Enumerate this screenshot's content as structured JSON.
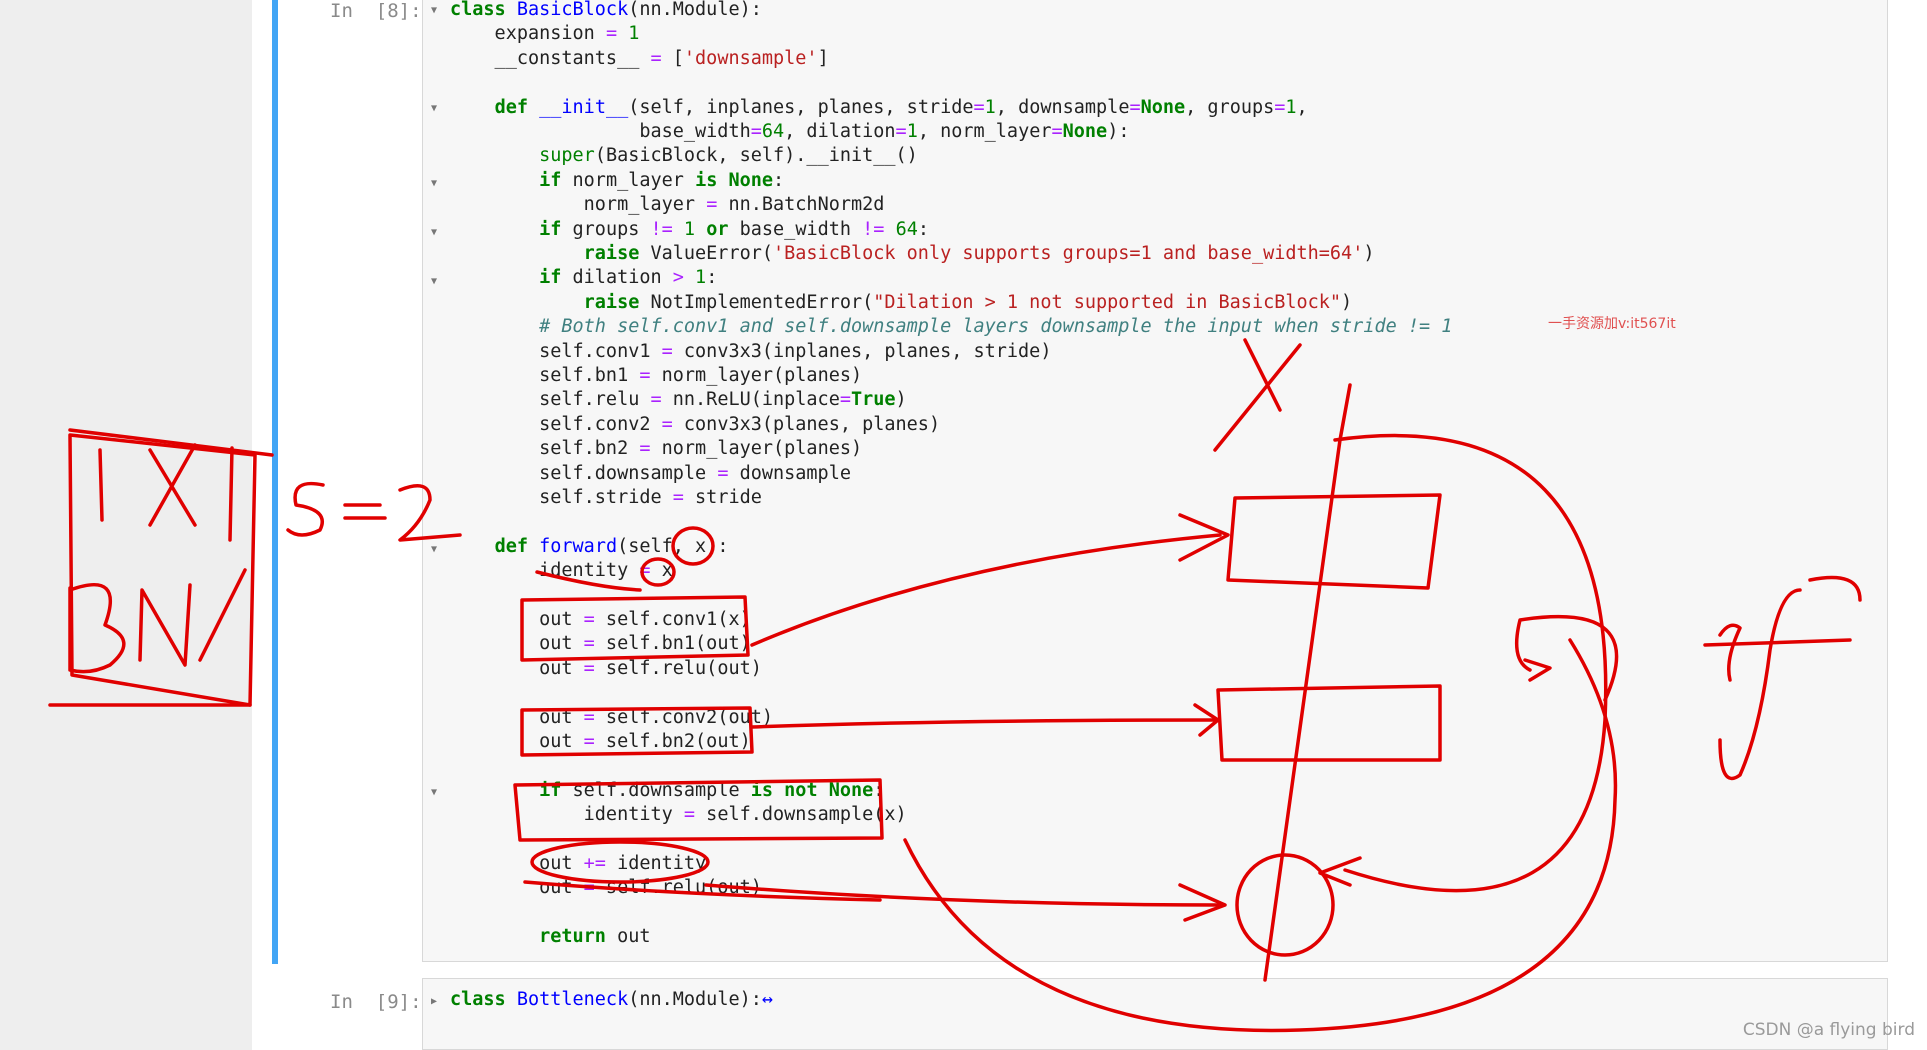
{
  "cells": [
    {
      "prompt": "In  [8]:",
      "lines": [
        [
          [
            "kw",
            "class "
          ],
          [
            "nc",
            "BasicBlock"
          ],
          [
            "",
            "(nn.Module):"
          ]
        ],
        [
          [
            "",
            "    expansion "
          ],
          [
            "op",
            "="
          ],
          [
            "nu",
            " 1"
          ]
        ],
        [
          [
            "",
            "    __constants__ "
          ],
          [
            "op",
            "="
          ],
          [
            "",
            " ["
          ],
          [
            "st",
            "'downsample'"
          ],
          [
            "",
            "]"
          ]
        ],
        [
          [
            "",
            ""
          ]
        ],
        [
          [
            "",
            "    "
          ],
          [
            "kw",
            "def "
          ],
          [
            "nf",
            "__init__"
          ],
          [
            "",
            "(self, inplanes, planes, stride"
          ],
          [
            "op",
            "="
          ],
          [
            "nu",
            "1"
          ],
          [
            "",
            ", downsample"
          ],
          [
            "op",
            "="
          ],
          [
            "kc",
            "None"
          ],
          [
            "",
            ", groups"
          ],
          [
            "op",
            "="
          ],
          [
            "nu",
            "1"
          ],
          [
            "",
            ","
          ]
        ],
        [
          [
            "",
            "                 base_width"
          ],
          [
            "op",
            "="
          ],
          [
            "nu",
            "64"
          ],
          [
            "",
            ", dilation"
          ],
          [
            "op",
            "="
          ],
          [
            "nu",
            "1"
          ],
          [
            "",
            ", norm_layer"
          ],
          [
            "op",
            "="
          ],
          [
            "kc",
            "None"
          ],
          [
            "",
            "):"
          ]
        ],
        [
          [
            "",
            "        "
          ],
          [
            "bi",
            "super"
          ],
          [
            "",
            "(BasicBlock, self).__init__()"
          ]
        ],
        [
          [
            "",
            "        "
          ],
          [
            "kw",
            "if "
          ],
          [
            "",
            "norm_layer "
          ],
          [
            "kw",
            "is "
          ],
          [
            "kc",
            "None"
          ],
          [
            "",
            ":"
          ]
        ],
        [
          [
            "",
            "            norm_layer "
          ],
          [
            "op",
            "="
          ],
          [
            "",
            " nn.BatchNorm2d"
          ]
        ],
        [
          [
            "",
            "        "
          ],
          [
            "kw",
            "if "
          ],
          [
            "",
            "groups "
          ],
          [
            "op",
            "!="
          ],
          [
            "nu",
            " 1 "
          ],
          [
            "kw",
            "or "
          ],
          [
            "",
            "base_width "
          ],
          [
            "op",
            "!="
          ],
          [
            "nu",
            " 64"
          ],
          [
            "",
            ":"
          ]
        ],
        [
          [
            "",
            "            "
          ],
          [
            "kw",
            "raise "
          ],
          [
            "",
            "ValueError("
          ],
          [
            "st",
            "'BasicBlock only supports groups=1 and base_width=64'"
          ],
          [
            "",
            ")"
          ]
        ],
        [
          [
            "",
            "        "
          ],
          [
            "kw",
            "if "
          ],
          [
            "",
            "dilation "
          ],
          [
            "op",
            ">"
          ],
          [
            "nu",
            " 1"
          ],
          [
            "",
            ":"
          ]
        ],
        [
          [
            "",
            "            "
          ],
          [
            "kw",
            "raise "
          ],
          [
            "",
            "NotImplementedError("
          ],
          [
            "st",
            "\"Dilation > 1 not supported in BasicBlock\""
          ],
          [
            "",
            ")"
          ]
        ],
        [
          [
            "",
            "        "
          ],
          [
            "cm",
            "# Both self.conv1 and self.downsample layers downsample the input when stride != 1"
          ]
        ],
        [
          [
            "",
            "        self.conv1 "
          ],
          [
            "op",
            "="
          ],
          [
            "",
            " conv3x3(inplanes, planes, stride)"
          ]
        ],
        [
          [
            "",
            "        self.bn1 "
          ],
          [
            "op",
            "="
          ],
          [
            "",
            " norm_layer(planes)"
          ]
        ],
        [
          [
            "",
            "        self.relu "
          ],
          [
            "op",
            "="
          ],
          [
            "",
            " nn.ReLU(inplace"
          ],
          [
            "op",
            "="
          ],
          [
            "kc",
            "True"
          ],
          [
            "",
            ")"
          ]
        ],
        [
          [
            "",
            "        self.conv2 "
          ],
          [
            "op",
            "="
          ],
          [
            "",
            " conv3x3(planes, planes)"
          ]
        ],
        [
          [
            "",
            "        self.bn2 "
          ],
          [
            "op",
            "="
          ],
          [
            "",
            " norm_layer(planes)"
          ]
        ],
        [
          [
            "",
            "        self.downsample "
          ],
          [
            "op",
            "="
          ],
          [
            "",
            " downsample"
          ]
        ],
        [
          [
            "",
            "        self.stride "
          ],
          [
            "op",
            "="
          ],
          [
            "",
            " stride"
          ]
        ],
        [
          [
            "",
            ""
          ]
        ],
        [
          [
            "",
            "    "
          ],
          [
            "kw",
            "def "
          ],
          [
            "nf",
            "forward"
          ],
          [
            "",
            "(self, x):"
          ]
        ],
        [
          [
            "",
            "        identity "
          ],
          [
            "op",
            "="
          ],
          [
            "",
            " x"
          ]
        ],
        [
          [
            "",
            ""
          ]
        ],
        [
          [
            "",
            "        out "
          ],
          [
            "op",
            "="
          ],
          [
            "",
            " self.conv1(x)"
          ]
        ],
        [
          [
            "",
            "        out "
          ],
          [
            "op",
            "="
          ],
          [
            "",
            " self.bn1(out)"
          ]
        ],
        [
          [
            "",
            "        out "
          ],
          [
            "op",
            "="
          ],
          [
            "",
            " self.relu(out)"
          ]
        ],
        [
          [
            "",
            ""
          ]
        ],
        [
          [
            "",
            "        out "
          ],
          [
            "op",
            "="
          ],
          [
            "",
            " self.conv2(out)"
          ]
        ],
        [
          [
            "",
            "        out "
          ],
          [
            "op",
            "="
          ],
          [
            "",
            " self.bn2(out)"
          ]
        ],
        [
          [
            "",
            ""
          ]
        ],
        [
          [
            "",
            "        "
          ],
          [
            "kw",
            "if "
          ],
          [
            "",
            "self.downsample "
          ],
          [
            "kw",
            "is not "
          ],
          [
            "kc",
            "None"
          ],
          [
            "",
            ":"
          ]
        ],
        [
          [
            "",
            "            identity "
          ],
          [
            "op",
            "="
          ],
          [
            "",
            " self.downsample(x)"
          ]
        ],
        [
          [
            "",
            ""
          ]
        ],
        [
          [
            "",
            "        out "
          ],
          [
            "op",
            "+="
          ],
          [
            "",
            " identity"
          ]
        ],
        [
          [
            "",
            "        out "
          ],
          [
            "op",
            "="
          ],
          [
            "",
            " self.relu(out)"
          ]
        ],
        [
          [
            "",
            ""
          ]
        ],
        [
          [
            "",
            "        "
          ],
          [
            "kw",
            "return "
          ],
          [
            "",
            "out"
          ]
        ]
      ]
    },
    {
      "prompt": "In  [9]:",
      "lines": [
        [
          [
            "kw",
            "class "
          ],
          [
            "nc",
            "Bottleneck"
          ],
          [
            "",
            "(nn.Module):"
          ],
          [
            "nf",
            "↔"
          ]
        ]
      ]
    }
  ],
  "annotations": {
    "handwriting": [
      "1X1",
      "BN",
      "s=2",
      "X",
      "if"
    ]
  },
  "watermarks": {
    "chinese": "一手资源加v:it567it",
    "csdn": "CSDN @a flying bird"
  },
  "colors": {
    "active_cell_border": "#42a5f5",
    "ink": "#e00000"
  }
}
